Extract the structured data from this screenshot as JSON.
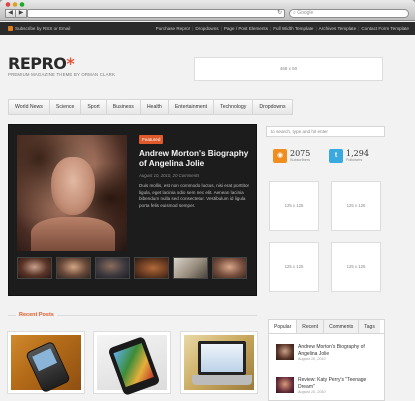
{
  "browser": {
    "back_icon": "back-arrow-icon",
    "forward_icon": "forward-arrow-icon",
    "new_tab_icon": "plus-icon",
    "search_placeholder": "Google"
  },
  "topbar": {
    "subscribe": "Subscribe",
    "by": "by",
    "rss": "RSS",
    "or": "or",
    "email": "Email",
    "links": [
      "Purchase Repro!",
      "Dropdowns",
      "Page / Post Elements",
      "Full Width Template",
      "Archives Template",
      "Contact Form Template"
    ]
  },
  "header": {
    "logo_text": "REPRO",
    "logo_star": "*",
    "tagline": "PREMIUM MAGAZINE THEME BY ORMAN CLARK",
    "banner_label": "468 x 60"
  },
  "nav": [
    "World News",
    "Science",
    "Sport",
    "Business",
    "Health",
    "Entertainment",
    "Technology",
    "Dropdowns"
  ],
  "featured": {
    "badge": "Featured",
    "title": "Andrew Morton's Biography of Angelina Jolie",
    "date": "August 10, 2010, 20 Comments",
    "excerpt": "Duis mollis, est non commodo luctus, nisi erat porttitor ligula, eget lacinia odio sem nec elit. Aenean lacinia bibendum nulla sed consectetur. Vestibulum id ligula porta felis euismod semper."
  },
  "sidebar": {
    "search_placeholder": "to search, type and hit enter",
    "rss_count": "2075",
    "rss_label": "Subscribers",
    "twitter_count": "1,294",
    "twitter_label": "Followers",
    "rss_icon": "rss-icon",
    "twitter_icon": "twitter-icon",
    "ad_label": "125 x 125"
  },
  "recent": {
    "heading": "Recent Posts"
  },
  "tabs_widget": {
    "tabs": [
      "Popular",
      "Recent",
      "Comments",
      "Tags"
    ],
    "items": [
      {
        "title": "Andrew Morton's Biography of Angelina Jolie",
        "date": "August 10, 2010"
      },
      {
        "title": "Review: Katy Perry's \"Teenage Dream\"",
        "date": "August 10, 2010"
      }
    ]
  },
  "colors": {
    "accent": "#e05a2b",
    "topbar": "#2b2b2b",
    "featured_bg": "#1c1c1c"
  }
}
